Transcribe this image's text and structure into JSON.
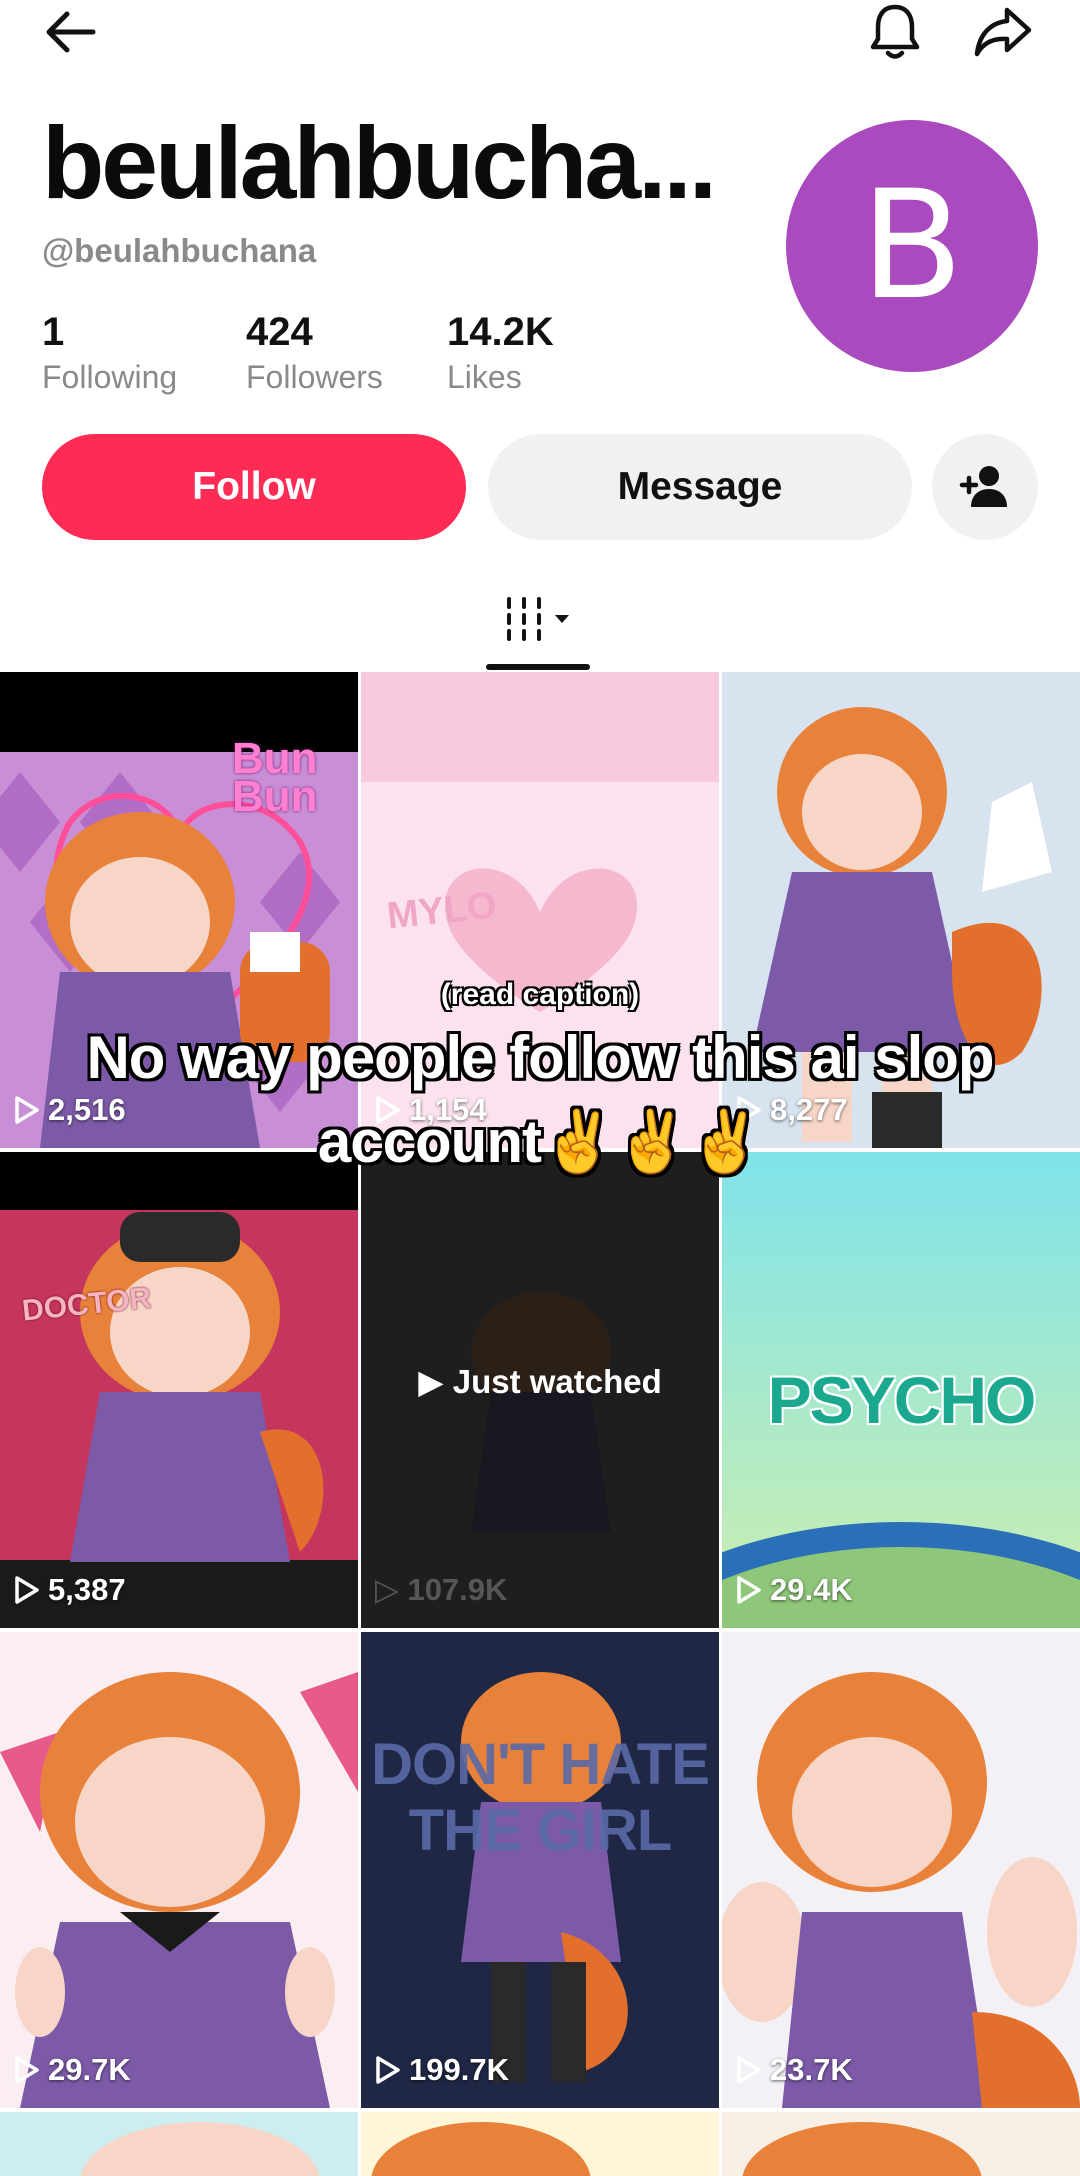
{
  "profile": {
    "display_name": "beulahbucha...",
    "handle": "@beulahbuchana",
    "avatar_letter": "B",
    "avatar_color": "#a94bbf"
  },
  "stats": {
    "following": {
      "value": "1",
      "label": "Following"
    },
    "followers": {
      "value": "424",
      "label": "Followers"
    },
    "likes": {
      "value": "14.2K",
      "label": "Likes"
    }
  },
  "actions": {
    "follow_label": "Follow",
    "message_label": "Message",
    "follow_color": "#fe2c55"
  },
  "icons": {
    "back": "arrow-left-icon",
    "bell": "bell-icon",
    "share": "share-icon",
    "add_friend": "add-user-icon",
    "grid_tab": "grid-icon"
  },
  "videos": [
    {
      "views": "2,516",
      "label_art": "Bun Bun"
    },
    {
      "views": "1,154",
      "label_art": "MYLO"
    },
    {
      "views": "8,277"
    },
    {
      "views": "5,387",
      "label_art": "DOCTOR"
    },
    {
      "views": "107.9K",
      "status": "Just watched"
    },
    {
      "views": "29.4K",
      "label_art": "PSYCHO"
    },
    {
      "views": "29.7K"
    },
    {
      "views": "199.7K",
      "label_art": "DON'T HATE THE GIRL"
    },
    {
      "views": "23.7K"
    }
  ],
  "caption": {
    "small": "(read caption)",
    "main": "No way people follow this ai slop account✌️✌️✌️"
  }
}
